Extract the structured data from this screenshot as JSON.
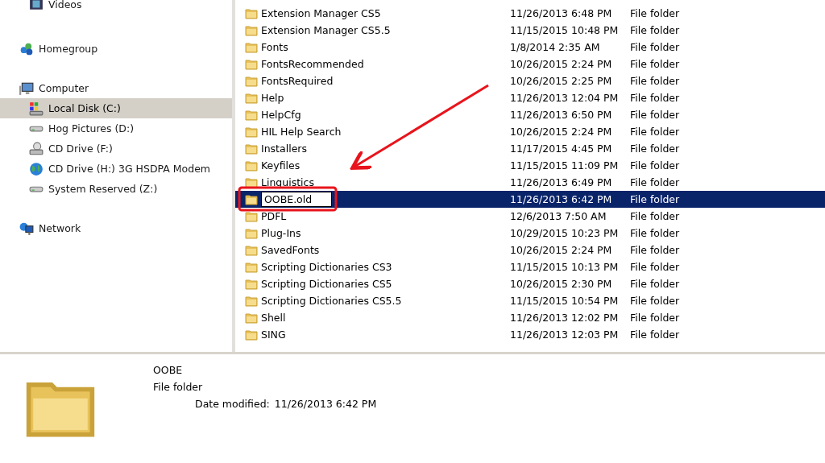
{
  "sidebar": {
    "items": [
      {
        "children": [
          {
            "label": "Videos",
            "kind": "video",
            "selected": false
          }
        ]
      },
      {
        "label": "Homegroup",
        "kind": "homegroup",
        "selected": false
      },
      {
        "label": "Computer",
        "kind": "computer",
        "selected": false,
        "children": [
          {
            "label": "Local Disk (C:)",
            "kind": "system-drive",
            "selected": true
          },
          {
            "label": "Hog Pictures (D:)",
            "kind": "drive",
            "selected": false
          },
          {
            "label": "CD Drive (F:)",
            "kind": "cd",
            "selected": false
          },
          {
            "label": "CD Drive (H:) 3G HSDPA Modem",
            "kind": "globe",
            "selected": false
          },
          {
            "label": "System Reserved (Z:)",
            "kind": "drive",
            "selected": false
          }
        ]
      },
      {
        "label": "Network",
        "kind": "network",
        "selected": false
      }
    ]
  },
  "files": {
    "rows": [
      {
        "name": "Extension Manager CS5",
        "date": "11/26/2013 6:48 PM",
        "type": "File folder",
        "selected": false,
        "renaming": false
      },
      {
        "name": "Extension Manager CS5.5",
        "date": "11/15/2015 10:48 PM",
        "type": "File folder",
        "selected": false,
        "renaming": false
      },
      {
        "name": "Fonts",
        "date": "1/8/2014 2:35 AM",
        "type": "File folder",
        "selected": false,
        "renaming": false
      },
      {
        "name": "FontsRecommended",
        "date": "10/26/2015 2:24 PM",
        "type": "File folder",
        "selected": false,
        "renaming": false
      },
      {
        "name": "FontsRequired",
        "date": "10/26/2015 2:25 PM",
        "type": "File folder",
        "selected": false,
        "renaming": false
      },
      {
        "name": "Help",
        "date": "11/26/2013 12:04 PM",
        "type": "File folder",
        "selected": false,
        "renaming": false
      },
      {
        "name": "HelpCfg",
        "date": "11/26/2013 6:50 PM",
        "type": "File folder",
        "selected": false,
        "renaming": false
      },
      {
        "name": "HIL Help Search",
        "date": "10/26/2015 2:24 PM",
        "type": "File folder",
        "selected": false,
        "renaming": false
      },
      {
        "name": "Installers",
        "date": "11/17/2015 4:45 PM",
        "type": "File folder",
        "selected": false,
        "renaming": false
      },
      {
        "name": "Keyfiles",
        "date": "11/15/2015 11:09 PM",
        "type": "File folder",
        "selected": false,
        "renaming": false
      },
      {
        "name": "Linguistics",
        "date": "11/26/2013 6:49 PM",
        "type": "File folder",
        "selected": false,
        "renaming": false
      },
      {
        "name": "OOBE.old",
        "date": "11/26/2013 6:42 PM",
        "type": "File folder",
        "selected": true,
        "renaming": true
      },
      {
        "name": "PDFL",
        "date": "12/6/2013 7:50 AM",
        "type": "File folder",
        "selected": false,
        "renaming": false
      },
      {
        "name": "Plug-Ins",
        "date": "10/29/2015 10:23 PM",
        "type": "File folder",
        "selected": false,
        "renaming": false
      },
      {
        "name": "SavedFonts",
        "date": "10/26/2015 2:24 PM",
        "type": "File folder",
        "selected": false,
        "renaming": false
      },
      {
        "name": "Scripting Dictionaries CS3",
        "date": "11/15/2015 10:13 PM",
        "type": "File folder",
        "selected": false,
        "renaming": false
      },
      {
        "name": "Scripting Dictionaries CS5",
        "date": "10/26/2015 2:30 PM",
        "type": "File folder",
        "selected": false,
        "renaming": false
      },
      {
        "name": "Scripting Dictionaries CS5.5",
        "date": "11/15/2015 10:54 PM",
        "type": "File folder",
        "selected": false,
        "renaming": false
      },
      {
        "name": "Shell",
        "date": "11/26/2013 12:02 PM",
        "type": "File folder",
        "selected": false,
        "renaming": false
      },
      {
        "name": "SING",
        "date": "11/26/2013 12:03 PM",
        "type": "File folder",
        "selected": false,
        "renaming": false
      }
    ]
  },
  "details": {
    "name": "OOBE",
    "type": "File folder",
    "date_label": "Date modified:",
    "date": "11/26/2013 6:42 PM"
  }
}
